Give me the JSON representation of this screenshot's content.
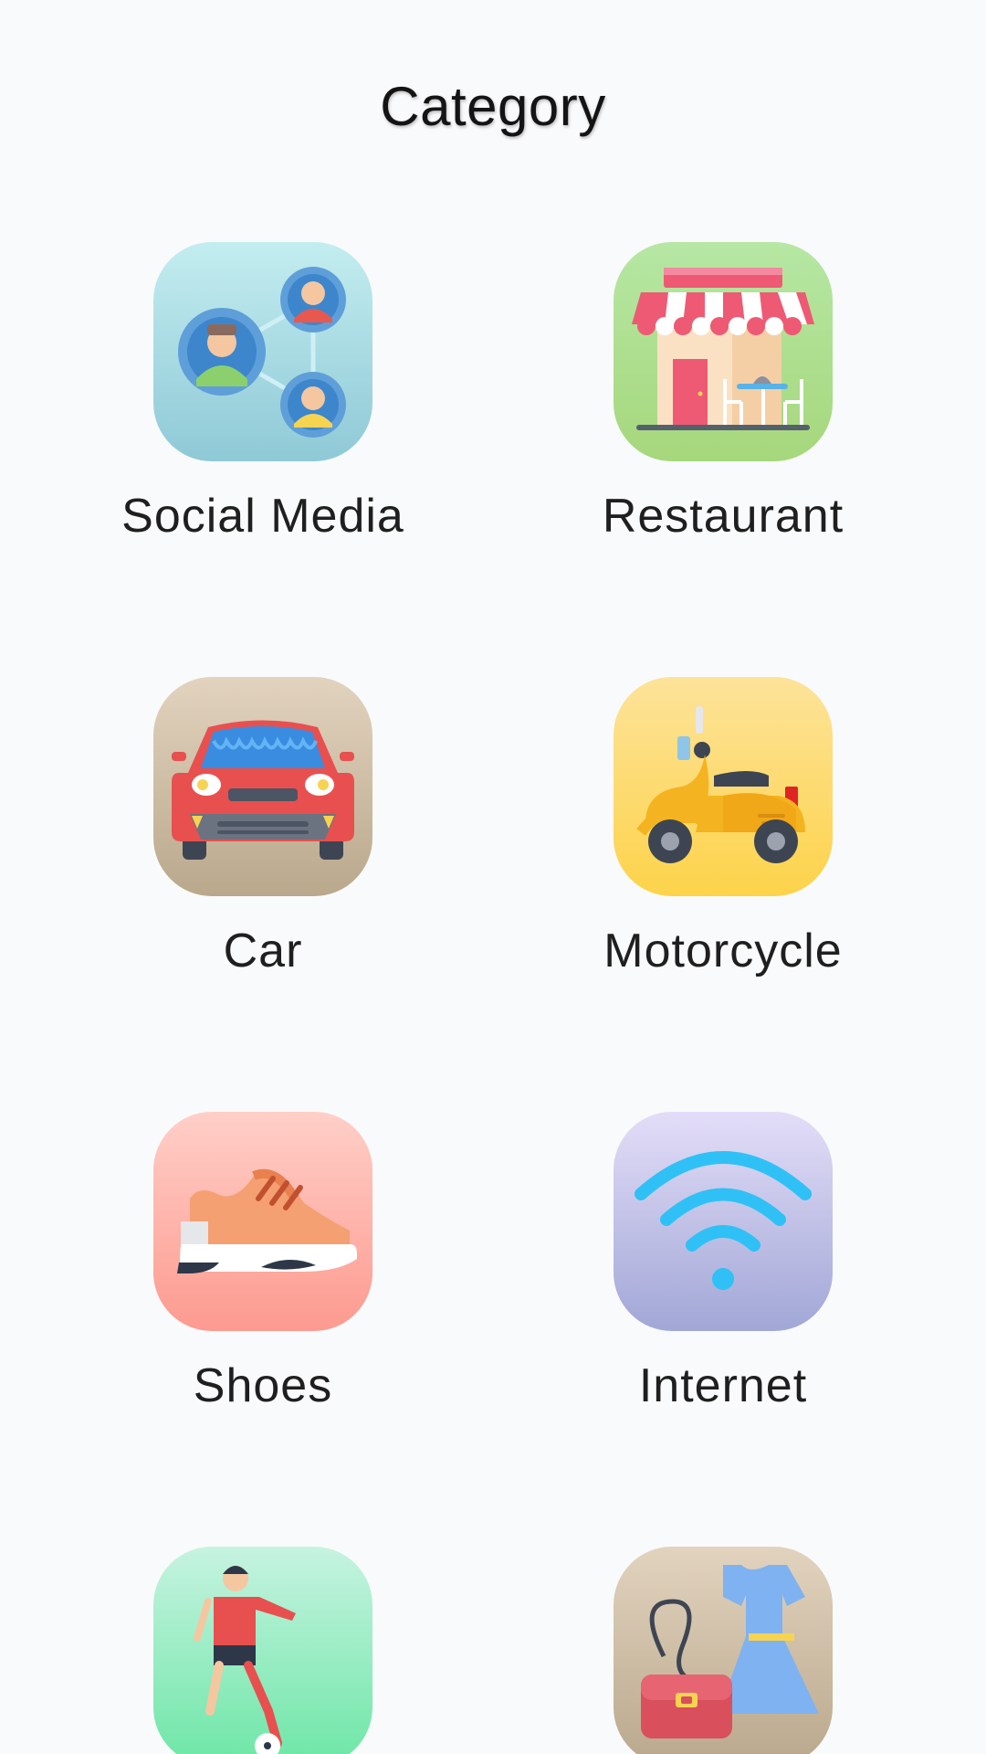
{
  "header": {
    "title": "Category"
  },
  "categories": [
    {
      "label": "Social Media",
      "icon": "social-media-icon"
    },
    {
      "label": "Restaurant",
      "icon": "restaurant-icon"
    },
    {
      "label": "Car",
      "icon": "car-icon"
    },
    {
      "label": "Motorcycle",
      "icon": "motorcycle-icon"
    },
    {
      "label": "Shoes",
      "icon": "shoes-icon"
    },
    {
      "label": "Internet",
      "icon": "wifi-icon"
    },
    {
      "label": "",
      "icon": "soccer-player-icon"
    },
    {
      "label": "",
      "icon": "dress-and-bag-icon"
    }
  ]
}
